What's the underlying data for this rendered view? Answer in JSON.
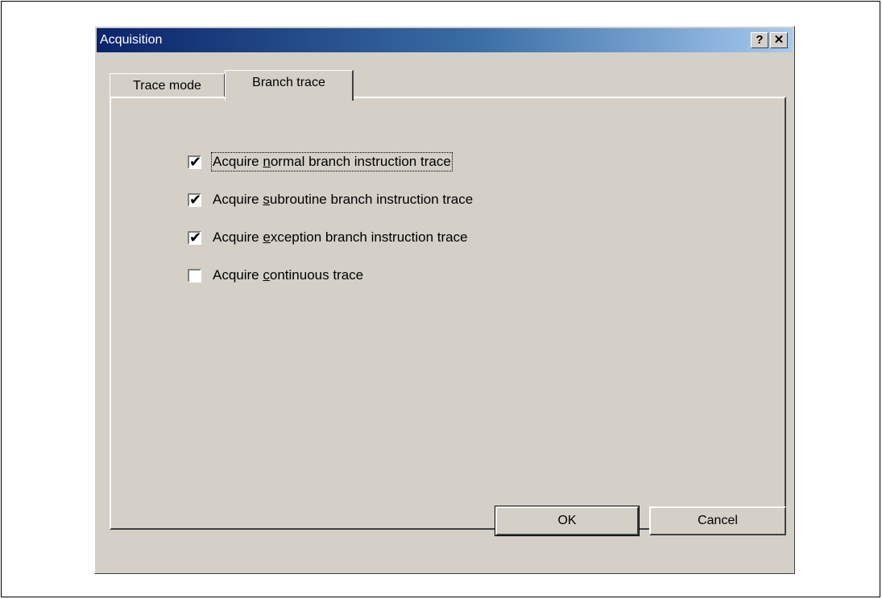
{
  "window": {
    "title": "Acquisition",
    "help_label": "?",
    "close_label": "✕"
  },
  "tabs": [
    {
      "label": "Trace mode",
      "selected": false
    },
    {
      "label": "Branch trace",
      "selected": true
    }
  ],
  "options": [
    {
      "label_pre": "Acquire ",
      "label_key": "n",
      "label_post": "ormal branch instruction trace",
      "checked": true,
      "focused": true
    },
    {
      "label_pre": "Acquire ",
      "label_key": "s",
      "label_post": "ubroutine branch instruction trace",
      "checked": true,
      "focused": false
    },
    {
      "label_pre": "Acquire ",
      "label_key": "e",
      "label_post": "xception branch instruction trace",
      "checked": true,
      "focused": false
    },
    {
      "label_pre": "Acquire ",
      "label_key": "c",
      "label_post": "ontinuous trace",
      "checked": false,
      "focused": false
    }
  ],
  "buttons": {
    "ok_label": "OK",
    "cancel_label": "Cancel"
  },
  "check_glyph": "✔"
}
